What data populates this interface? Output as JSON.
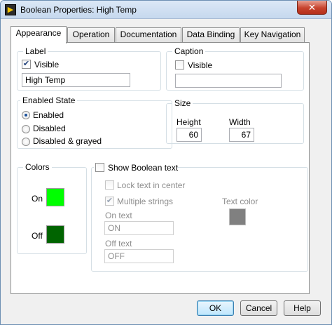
{
  "window": {
    "title": "Boolean Properties: High Temp",
    "close_glyph": "✕"
  },
  "tabs": [
    {
      "label": "Appearance",
      "active": true
    },
    {
      "label": "Operation",
      "active": false
    },
    {
      "label": "Documentation",
      "active": false
    },
    {
      "label": "Data Binding",
      "active": false
    },
    {
      "label": "Key Navigation",
      "active": false
    }
  ],
  "label_group": {
    "title": "Label",
    "visible_label": "Visible",
    "visible_checked": true,
    "value": "High Temp"
  },
  "caption_group": {
    "title": "Caption",
    "visible_label": "Visible",
    "visible_checked": false,
    "value": ""
  },
  "enabled_state": {
    "title": "Enabled State",
    "options": [
      "Enabled",
      "Disabled",
      "Disabled & grayed"
    ],
    "selected": "Enabled"
  },
  "size": {
    "title": "Size",
    "height_label": "Height",
    "height_value": "60",
    "width_label": "Width",
    "width_value": "67"
  },
  "colors": {
    "title": "Colors",
    "on_label": "On",
    "on_color": "#00ff00",
    "off_label": "Off",
    "off_color": "#006400"
  },
  "boolean_text": {
    "show_label": "Show Boolean text",
    "show_checked": false,
    "lock_label": "Lock text in center",
    "lock_checked": false,
    "multiple_label": "Multiple strings",
    "multiple_checked": true,
    "on_text_label": "On text",
    "on_text_value": "ON",
    "off_text_label": "Off text",
    "off_text_value": "OFF",
    "text_color_label": "Text color",
    "text_color": "#808080"
  },
  "buttons": {
    "ok": "OK",
    "cancel": "Cancel",
    "help": "Help"
  }
}
